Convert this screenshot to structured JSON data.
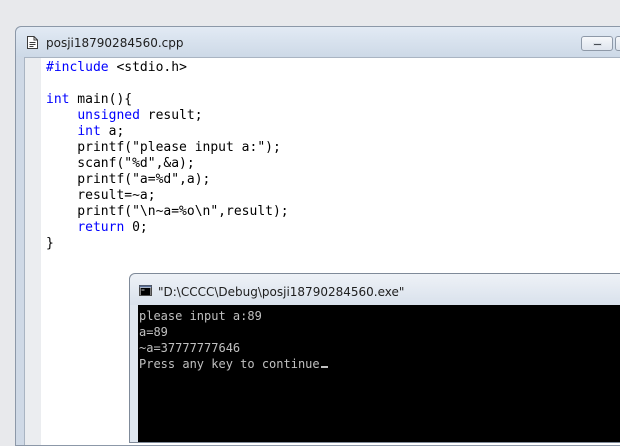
{
  "editor": {
    "title": "posji18790284560.cpp",
    "icon": "document-icon",
    "keyword_color": "#0000ff",
    "code_lines": [
      [
        {
          "text": "#include",
          "kw": true
        },
        {
          "text": " <stdio.h>"
        }
      ],
      [],
      [
        {
          "text": "int",
          "kw": true
        },
        {
          "text": " main(){"
        }
      ],
      [
        {
          "text": "    "
        },
        {
          "text": "unsigned",
          "kw": true
        },
        {
          "text": " result;"
        }
      ],
      [
        {
          "text": "    "
        },
        {
          "text": "int",
          "kw": true
        },
        {
          "text": " a;"
        }
      ],
      [
        {
          "text": "    printf(\"please input a:\");"
        }
      ],
      [
        {
          "text": "    scanf(\"%d\",&a);"
        }
      ],
      [
        {
          "text": "    printf(\"a=%d\",a);"
        }
      ],
      [
        {
          "text": "    result=~a;"
        }
      ],
      [
        {
          "text": "    printf(\"\\n~a=%o\\n\",result);"
        }
      ],
      [
        {
          "text": "    "
        },
        {
          "text": "return",
          "kw": true
        },
        {
          "text": " 0;"
        }
      ],
      [
        {
          "text": "}"
        }
      ]
    ]
  },
  "console": {
    "title": "\"D:\\CCCC\\Debug\\posji18790284560.exe\"",
    "icon": "console-icon",
    "background": "#000000",
    "text_color": "#c0c0c0",
    "lines": [
      "please input a:89",
      "a=89",
      "~a=37777777646",
      "Press any key to continue"
    ]
  }
}
